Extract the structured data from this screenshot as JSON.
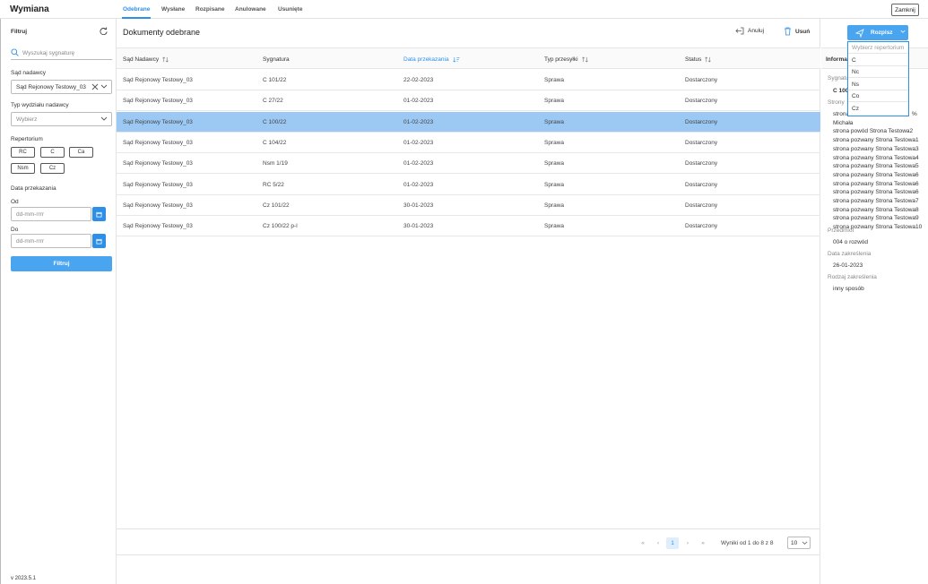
{
  "app": {
    "title": "Wymiana",
    "close_label": "Zamknij",
    "version": "v 2023.5.1"
  },
  "tabs": [
    {
      "label": "Odebrane",
      "active": true
    },
    {
      "label": "Wysłane"
    },
    {
      "label": "Rozpisane"
    },
    {
      "label": "Anulowane"
    },
    {
      "label": "Usunięte"
    }
  ],
  "filter": {
    "title": "Filtruj",
    "search_placeholder": "Wyszukaj sygnaturę",
    "court_label": "Sąd nadawcy",
    "court_value": "Sąd Rejonowy Testowy_03",
    "dept_label": "Typ wydziału nadawcy",
    "dept_value": "Wybierz",
    "repertorium_label": "Repertorium",
    "chips": [
      "RC",
      "C",
      "Ca",
      "Nsm",
      "Cz"
    ],
    "date_label": "Data przekazania",
    "from_label": "Od",
    "from_placeholder": "dd-mm-rrrr",
    "to_label": "Do",
    "to_placeholder": "dd-mm-rrrr",
    "button": "Filtruj"
  },
  "main": {
    "title": "Dokumenty odebrane",
    "actions": {
      "cancel": "Anuluj",
      "delete": "Usuń",
      "split": "Rozpisz"
    },
    "columns": [
      "Sąd Nadawcy",
      "Sygnatura",
      "Data przekazania",
      "Typ przesyłki",
      "Status"
    ],
    "rows": [
      [
        "Sąd Rejonowy Testowy_03",
        "C 101/22",
        "22-02-2023",
        "Sprawa",
        "Dostarczony"
      ],
      [
        "Sąd Rejonowy Testowy_03",
        "C 27/22",
        "01-02-2023",
        "Sprawa",
        "Dostarczony"
      ],
      [
        "Sąd Rejonowy Testowy_03",
        "C 100/22",
        "01-02-2023",
        "Sprawa",
        "Dostarczony"
      ],
      [
        "Sąd Rejonowy Testowy_03",
        "C 104/22",
        "01-02-2023",
        "Sprawa",
        "Dostarczony"
      ],
      [
        "Sąd Rejonowy Testowy_03",
        "Nsm 1/19",
        "01-02-2023",
        "Sprawa",
        "Dostarczony"
      ],
      [
        "Sąd Rejonowy Testowy_03",
        "RC 5/22",
        "01-02-2023",
        "Sprawa",
        "Dostarczony"
      ],
      [
        "Sąd Rejonowy Testowy_03",
        "Cz 101/22",
        "30-01-2023",
        "Sprawa",
        "Dostarczony"
      ],
      [
        "Sąd Rejonowy Testowy_03",
        "Cz 100/22 p-l",
        "30-01-2023",
        "Sprawa",
        "Dostarczony"
      ]
    ],
    "selected_row": 2,
    "pagination": {
      "current_page": "1",
      "results": "Wyniki od 1 do 8 z 8",
      "page_size": "10"
    }
  },
  "info": {
    "title": "Informa",
    "signature_label": "Sygnatu",
    "signature_value": "C 100",
    "parties_label": "Strony",
    "parties": [
      "strona",
      "Michała",
      "strona powód Strona Testowa2",
      "strona pozwany Strona Testowa1",
      "strona pozwany Strona Testowa3",
      "strona pozwany Strona Testowa4",
      "strona pozwany Strona Testowa5",
      "strona pozwany Strona Testowa6",
      "strona pozwany Strona Testowa6",
      "strona pozwany Strona Testowa6",
      "strona pozwany Strona Testowa7",
      "strona pozwany Strona Testowa8",
      "strona pozwany Strona Testowa9",
      "strona pozwany Strona Testowa10"
    ],
    "party_suffix": "%",
    "subject_label": "Przedmiot",
    "subject_value": "004 o rozwód",
    "date_label": "Data zakreślenia",
    "date_value": "26-01-2023",
    "kind_label": "Rodzaj zakreślenia",
    "kind_value": "inny sposób"
  },
  "dropdown": {
    "header": "Wybierz repertorium",
    "items": [
      "C",
      "Nc",
      "Ns",
      "Co",
      "Cz"
    ]
  },
  "colors": {
    "accent": "#2d8fe8",
    "button": "#4aa5f0",
    "selected_row": "#9cc8f4"
  }
}
